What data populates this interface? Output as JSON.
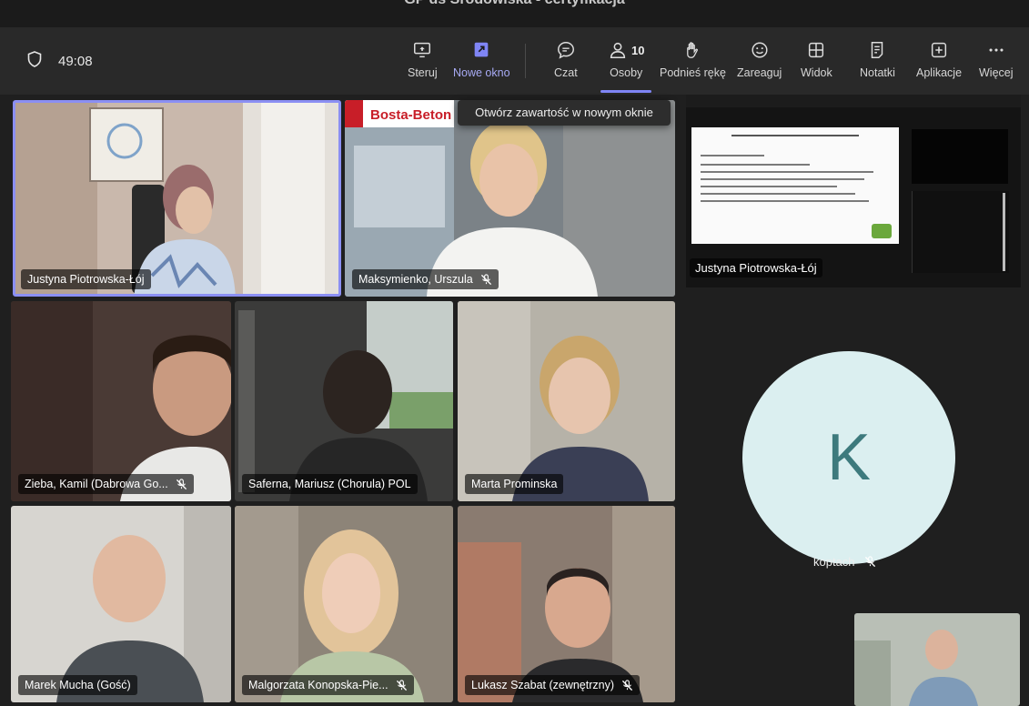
{
  "window": {
    "title": "GP ds Środowiska - certyfikacja"
  },
  "toolbar": {
    "timer": "49:08",
    "buttons": {
      "steruj": "Steruj",
      "nowe_okno": "Nowe okno",
      "czat": "Czat",
      "osoby": "Osoby",
      "osoby_count": "10",
      "podnies": "Podnieś rękę",
      "zareaguj": "Zareaguj",
      "widok": "Widok",
      "notatki": "Notatki",
      "aplikacje": "Aplikacje",
      "wiecej": "Więcej"
    },
    "tooltip": "Otwórz zawartość w nowym oknie"
  },
  "participants": [
    {
      "name": "Justyna Piotrowska-Łój",
      "muted": false
    },
    {
      "name": "Maksymienko, Urszula",
      "muted": true
    },
    {
      "name": "Zieba, Kamil (Dabrowa Go...",
      "muted": true
    },
    {
      "name": "Saferna, Mariusz (Chorula) POL",
      "muted": false
    },
    {
      "name": "Marta Prominska",
      "muted": false
    },
    {
      "name": "Marek Mucha (Gość)",
      "muted": false
    },
    {
      "name": "Malgorzata Konopska-Pie...",
      "muted": true
    },
    {
      "name": "Lukasz Szabat (zewnętrzny)",
      "muted": true
    }
  ],
  "branding": {
    "logo_text": "Bosta-Beton"
  },
  "share": {
    "presenter": "Justyna Piotrowska-Łój"
  },
  "koptach": {
    "initial": "K",
    "name": "koptach"
  },
  "colors": {
    "accent": "#7f85f5",
    "toolbar_bg": "#292929",
    "stage_bg": "#1f1f1f",
    "avatar_bg": "#dbeff0",
    "avatar_fg": "#3d7a7d"
  },
  "icons": [
    "shield-icon",
    "share-screen-icon",
    "pop-out-icon",
    "chat-icon",
    "people-icon",
    "raise-hand-icon",
    "smile-icon",
    "view-grid-icon",
    "notes-icon",
    "apps-icon",
    "more-icon",
    "mic-off-icon"
  ]
}
